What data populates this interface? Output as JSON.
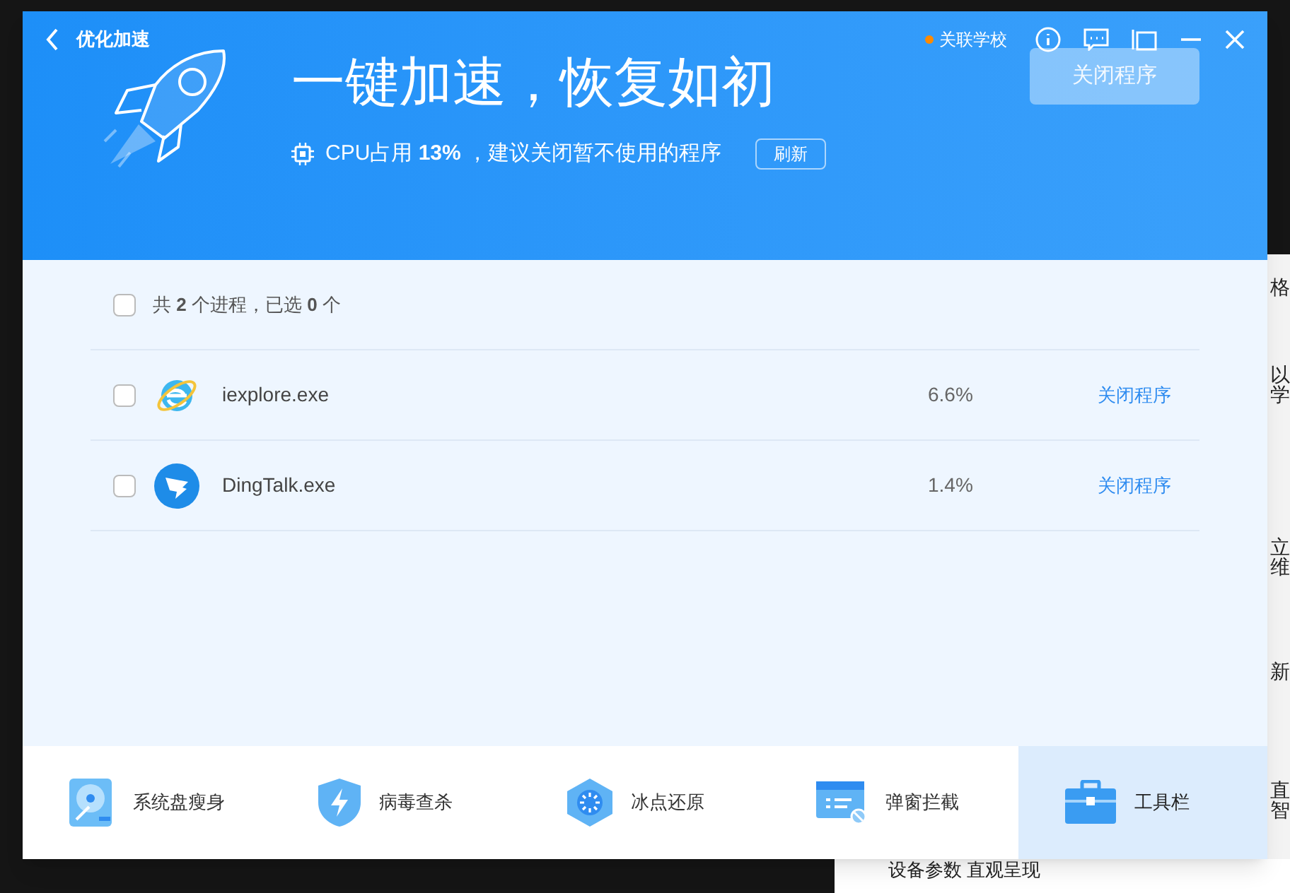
{
  "window": {
    "title": "优化加速",
    "school": "关联学校"
  },
  "hero": {
    "headline": "一键加速，恢复如初",
    "cpu_text": "CPU占用 **13%** ，建议关闭暂不使用的程序",
    "refresh_button": "刷新",
    "close_button": {
      "label": "关闭程序",
      "disabled": true
    }
  },
  "summary": {
    "checked": false,
    "text": "共 **2** 个进程，已选 **0** 个"
  },
  "processes": [
    {
      "name": "iexplore.exe",
      "kind": "ie",
      "cpu": "6.6%",
      "action": "关闭程序",
      "checked": false
    },
    {
      "name": "DingTalk.exe",
      "kind": "dingtalk",
      "cpu": "1.4%",
      "action": "关闭程序",
      "checked": false
    }
  ],
  "tools": [
    {
      "label": "系统盘瘦身",
      "kind": "disk",
      "selected": false
    },
    {
      "label": "病毒查杀",
      "kind": "shield",
      "selected": false
    },
    {
      "label": "冰点还原",
      "kind": "freeze",
      "selected": false
    },
    {
      "label": "弹窗拦截",
      "kind": "popup",
      "selected": false
    },
    {
      "label": "工具栏",
      "kind": "toolbox",
      "selected": true
    }
  ],
  "background_window": {
    "side_texts": [
      "格",
      "以",
      "学",
      "立",
      "维",
      "新",
      "直",
      "智"
    ],
    "caption": "设备参数 直观呈现"
  }
}
